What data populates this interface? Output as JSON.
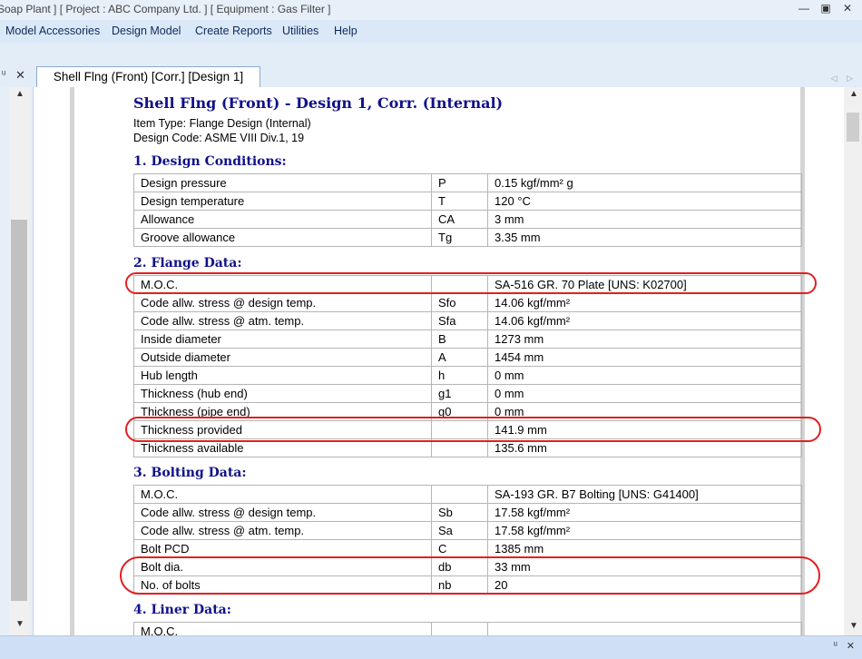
{
  "window": {
    "title": "Soap Plant ] [ Project : ABC Company Ltd. ] [ Equipment : Gas Filter ]",
    "controls": [
      "—",
      "▣",
      "✕"
    ]
  },
  "menu": {
    "items": [
      "Model Accessories",
      "Design Model",
      "Create Reports",
      "Utilities",
      "Help"
    ]
  },
  "tabs": {
    "pin_glyph": "ᵘ",
    "close_glyph": "✕",
    "active": "Shell Flng (Front) [Corr.] [Design 1]",
    "nav_arrows": "◁ ▷"
  },
  "document": {
    "title": "Shell Flng (Front) - Design 1, Corr. (Internal)",
    "item_type": "Item Type: Flange Design (Internal)",
    "design_code": "Design Code: ASME VIII Div.1, 19",
    "sections": [
      {
        "heading": "1. Design Conditions:",
        "rows": [
          [
            "Design pressure",
            "P",
            "0.15 kgf/mm² g"
          ],
          [
            "Design temperature",
            "T",
            "120 °C"
          ],
          [
            "Allowance",
            "CA",
            "3 mm"
          ],
          [
            "Groove allowance",
            "Tg",
            "3.35 mm"
          ]
        ]
      },
      {
        "heading": "2. Flange Data:",
        "rows": [
          [
            "M.O.C.",
            "",
            "SA-516 GR. 70 Plate [UNS: K02700]"
          ],
          [
            "Code allw. stress @ design temp.",
            "Sfo",
            "14.06 kgf/mm²"
          ],
          [
            "Code allw. stress @ atm. temp.",
            "Sfa",
            "14.06 kgf/mm²"
          ],
          [
            "Inside diameter",
            "B",
            "1273 mm"
          ],
          [
            "Outside diameter",
            "A",
            "1454 mm"
          ],
          [
            "Hub length",
            "h",
            "0 mm"
          ],
          [
            "Thickness (hub end)",
            "g1",
            "0 mm"
          ],
          [
            "Thickness (pipe end)",
            "g0",
            "0 mm"
          ],
          [
            "Thickness provided",
            "",
            "141.9 mm"
          ],
          [
            "Thickness available",
            "",
            "135.6 mm"
          ]
        ]
      },
      {
        "heading": "3. Bolting Data:",
        "rows": [
          [
            "M.O.C.",
            "",
            "SA-193 GR. B7 Bolting [UNS: G41400]"
          ],
          [
            "Code allw. stress @ design temp.",
            "Sb",
            "17.58 kgf/mm²"
          ],
          [
            "Code allw. stress @ atm. temp.",
            "Sa",
            "17.58 kgf/mm²"
          ],
          [
            "Bolt PCD",
            "C",
            "1385 mm"
          ],
          [
            "Bolt dia.",
            "db",
            "33 mm"
          ],
          [
            "No. of bolts",
            "nb",
            "20"
          ]
        ]
      },
      {
        "heading": "4. Liner Data:",
        "rows": [
          [
            "M.O.C.",
            "",
            ""
          ]
        ]
      }
    ]
  },
  "scroll": {
    "up": "▲",
    "down": "▼"
  },
  "status_icons": [
    "ᵘ",
    "✕"
  ],
  "colors": {
    "heading": "#10108a",
    "annotation": "#e02020",
    "chrome": "#dbe8f7"
  }
}
